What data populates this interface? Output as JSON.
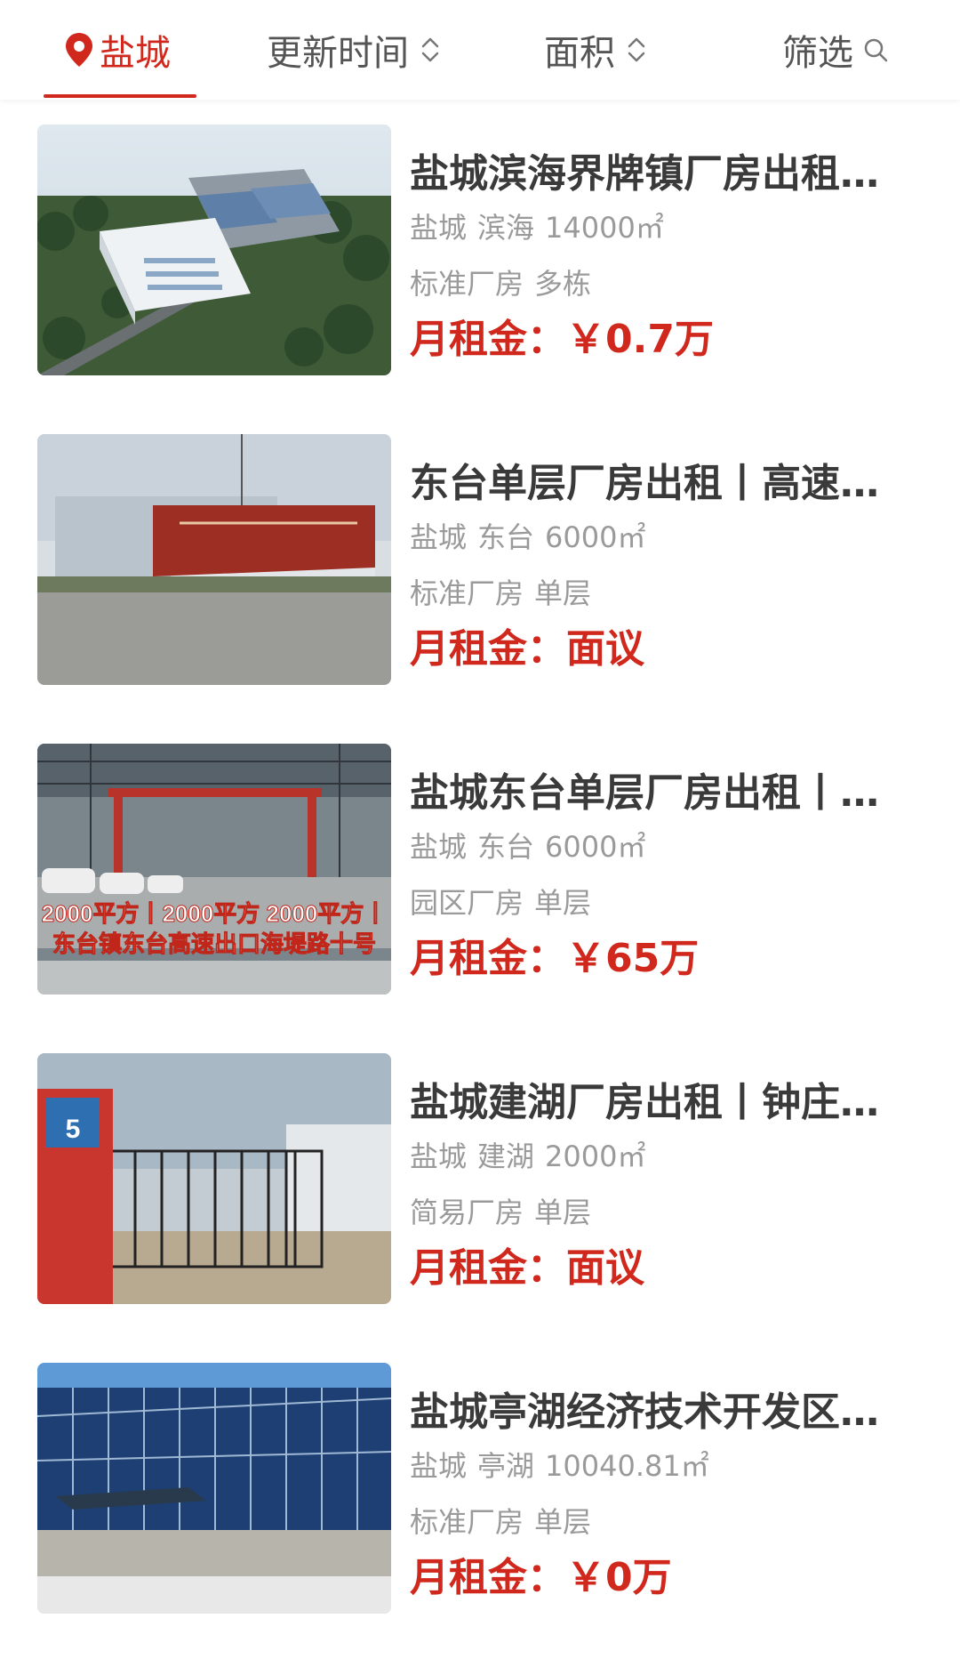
{
  "filter_bar": {
    "city": "盐城",
    "update_time": "更新时间",
    "area": "面积",
    "filter": "筛选",
    "accent_color": "#d0281c"
  },
  "listings": [
    {
      "title": "盐城滨海界牌镇厂房出租…",
      "city": "盐城",
      "district": "滨海",
      "size": "14000㎡",
      "category": "标准厂房",
      "floors": "多栋",
      "rent_label": "月租金：",
      "rent_value": "￥0.7万"
    },
    {
      "title": "东台单层厂房出租丨高速…",
      "city": "盐城",
      "district": "东台",
      "size": "6000㎡",
      "category": "标准厂房",
      "floors": "单层",
      "rent_label": "月租金：",
      "rent_value": "面议"
    },
    {
      "title": "盐城东台单层厂房出租丨…",
      "city": "盐城",
      "district": "东台",
      "size": "6000㎡",
      "category": "园区厂房",
      "floors": "单层",
      "rent_label": "月租金：",
      "rent_value": "￥65万",
      "image_caption_line1": "2000平方丨2000平方 2000平方丨",
      "image_caption_line2": "东台镇东台高速出口海堤路十号"
    },
    {
      "title": "盐城建湖厂房出租丨钟庄…",
      "city": "盐城",
      "district": "建湖",
      "size": "2000㎡",
      "category": "简易厂房",
      "floors": "单层",
      "rent_label": "月租金：",
      "rent_value": "面议",
      "image_sign_number": "5"
    },
    {
      "title": "盐城亭湖经济技术开发区…",
      "city": "盐城",
      "district": "亭湖",
      "size": "10040.81㎡",
      "category": "标准厂房",
      "floors": "单层",
      "rent_label": "月租金：",
      "rent_value": "￥0万"
    }
  ]
}
